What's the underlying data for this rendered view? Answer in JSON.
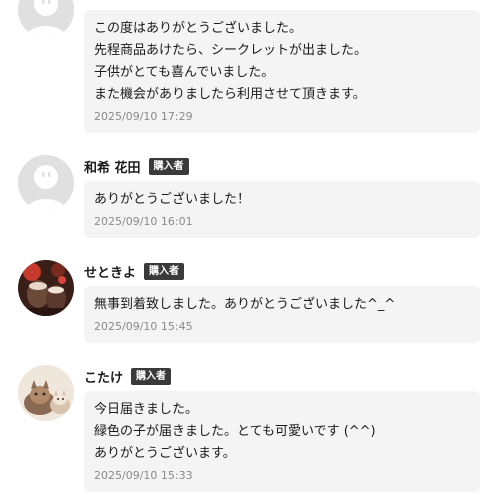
{
  "comments": [
    {
      "name": "",
      "badge": "",
      "avatar": "default-avatar",
      "lines": [
        "この度はありがとうございました。",
        "先程商品あけたら、シークレットが出ました。",
        "子供がとても喜んでいました。",
        "また機会がありましたら利用させて頂きます。"
      ],
      "date": "2025/09/10 17:29"
    },
    {
      "name": "和希 花田",
      "badge": "購入者",
      "avatar": "default-avatar",
      "lines": [
        "ありがとうございました！"
      ],
      "date": "2025/09/10 16:01"
    },
    {
      "name": "せときよ",
      "badge": "購入者",
      "avatar": "photo-avatar-drink",
      "lines": [
        "無事到着致しました。ありがとうございました^_^"
      ],
      "date": "2025/09/10 15:45"
    },
    {
      "name": "こたけ",
      "badge": "購入者",
      "avatar": "photo-avatar-cat",
      "lines": [
        "今日届きました。",
        "緑色の子が届きました。とても可愛いです (^^)",
        "ありがとうございます。"
      ],
      "date": "2025/09/10 15:33"
    }
  ],
  "colors": {
    "bubble_bg": "#f4f4f4",
    "badge_bg": "#3a3a3a",
    "date_text": "#8a8a8a",
    "avatar_default": "#e0e0e0"
  }
}
